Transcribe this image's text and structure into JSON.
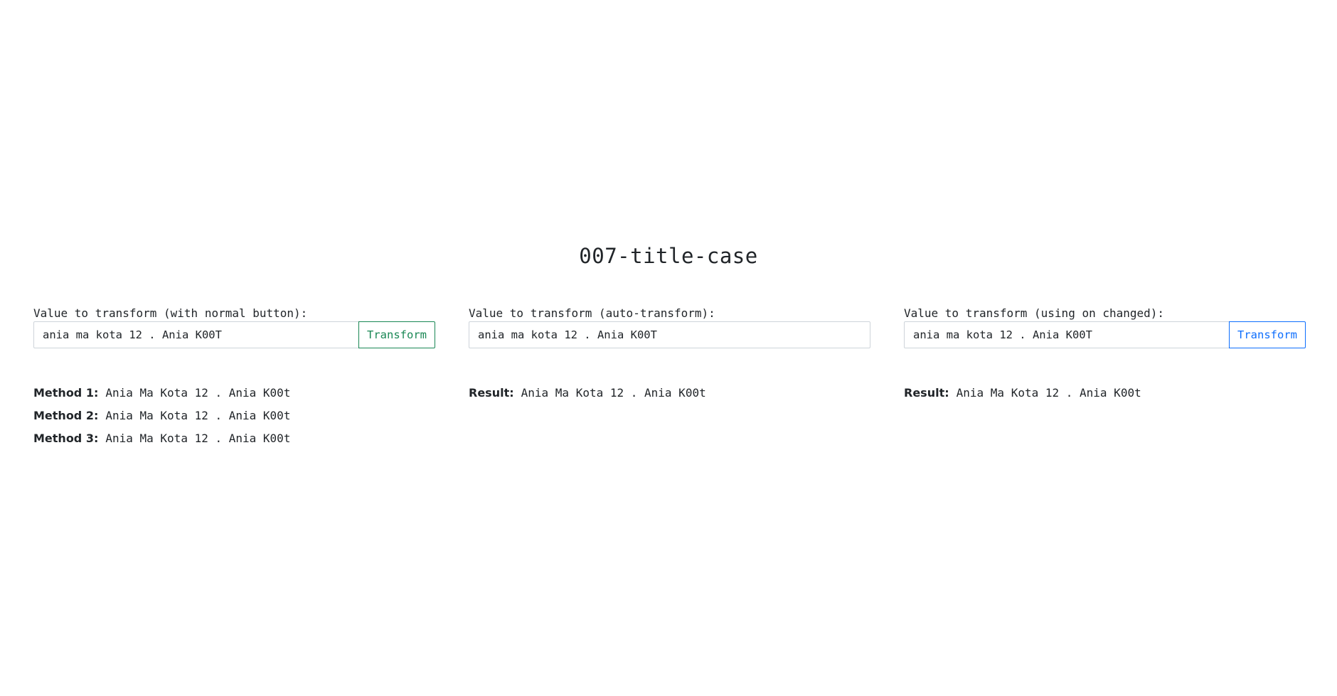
{
  "page": {
    "title": "007-title-case"
  },
  "columns": [
    {
      "label": "Value to transform (with normal button):",
      "input_value": "ania ma kota 12 . Ania K00T",
      "button_label": "Transform",
      "results": [
        {
          "label": "Method 1:",
          "value": "Ania Ma Kota 12 . Ania K00t"
        },
        {
          "label": "Method 2:",
          "value": "Ania Ma Kota 12 . Ania K00t"
        },
        {
          "label": "Method 3:",
          "value": "Ania Ma Kota 12 . Ania K00t"
        }
      ]
    },
    {
      "label": "Value to transform (auto-transform):",
      "input_value": "ania ma kota 12 . Ania K00T",
      "results": [
        {
          "label": "Result:",
          "value": "Ania Ma Kota 12 . Ania K00t"
        }
      ]
    },
    {
      "label": "Value to transform (using on changed):",
      "input_value": "ania ma kota 12 . Ania K00T",
      "button_label": "Transform",
      "results": [
        {
          "label": "Result:",
          "value": "Ania Ma Kota 12 . Ania K00t"
        }
      ]
    }
  ],
  "colors": {
    "button_normal": "#198754",
    "button_on_changed": "#0d6efd",
    "text": "#212529",
    "input_border": "#ced4da"
  }
}
